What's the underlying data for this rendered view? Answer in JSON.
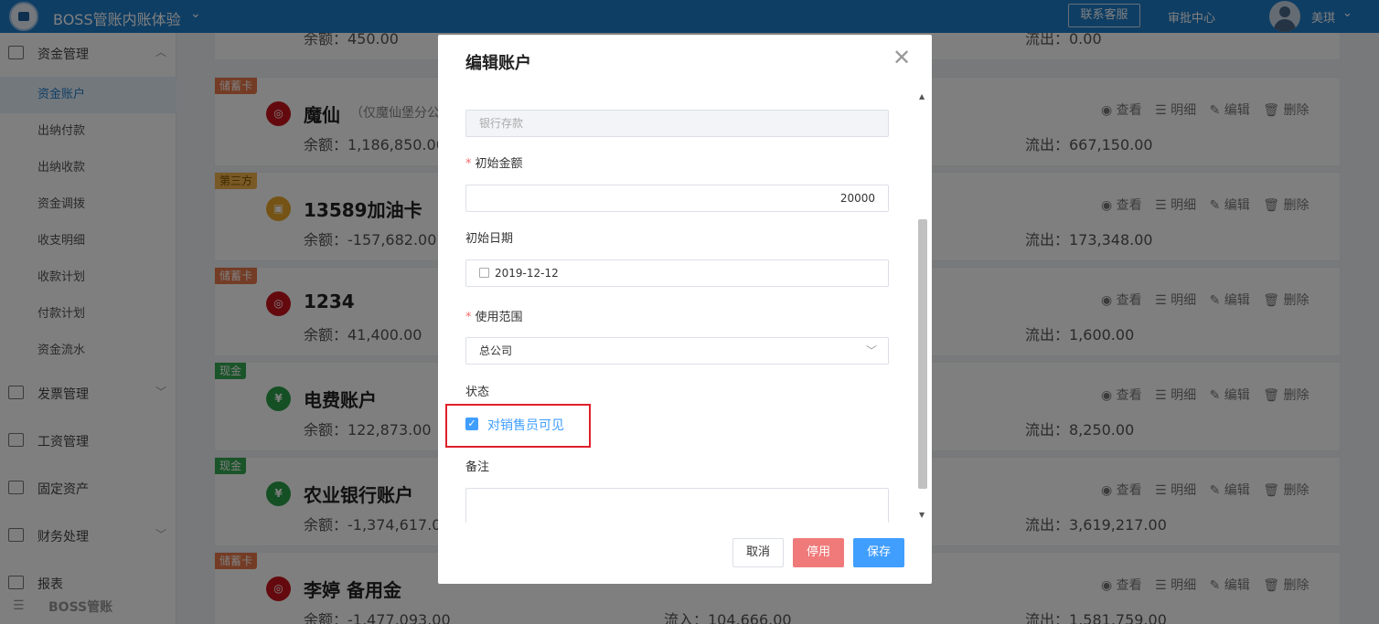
{
  "topbar": {
    "app_title": "BOSS管账内账体验",
    "contact_label": "联系客服",
    "approval_label": "审批中心",
    "username": "美琪"
  },
  "sidebar": {
    "fund_group": "资金管理",
    "items": [
      "资金账户",
      "出纳付款",
      "出纳收款",
      "资金调拨",
      "收支明细",
      "收款计划",
      "付款计划",
      "资金流水"
    ],
    "groups": [
      "发票管理",
      "工资管理",
      "固定资产",
      "财务处理",
      "报表"
    ],
    "bottom_brand": "BOSS管账"
  },
  "cards_top_partial": {
    "balance": "余额：450.00",
    "out": "流出：0.00"
  },
  "cards": [
    {
      "tag": "储蓄卡",
      "name": "魔仙",
      "sub": "（仅魔仙堡分公",
      "balance": "余额：1,186,850.00",
      "in": "",
      "out": "流出：667,150.00"
    },
    {
      "tag": "第三方",
      "name": "13589加油卡",
      "sub": "",
      "balance": "余额：-157,682.00",
      "in": "",
      "out": "流出：173,348.00"
    },
    {
      "tag": "储蓄卡",
      "name": "1234",
      "sub": "",
      "balance": "余额：41,400.00",
      "in": "",
      "out": "流出：1,600.00"
    },
    {
      "tag": "现金",
      "name": "电费账户",
      "sub": "",
      "balance": "余额：122,873.00",
      "in": "",
      "out": "流出：8,250.00"
    },
    {
      "tag": "现金",
      "name": "农业银行账户",
      "sub": "",
      "balance": "余额：-1,374,617.00",
      "in": "",
      "out": "流出：3,619,217.00"
    },
    {
      "tag": "储蓄卡",
      "name": "李婷 备用金",
      "sub": "",
      "balance": "余额：-1,477,093.00",
      "in": "流入：104,666.00",
      "out": "流出：1,581,759.00"
    }
  ],
  "card_actions": {
    "view": "查看",
    "detail": "明细",
    "edit": "编辑",
    "delete": "删除"
  },
  "dialog": {
    "title": "编辑账户",
    "subject_value": "银行存款",
    "initial_amount_label": "初始金额",
    "initial_amount_value": "20000",
    "initial_date_label": "初始日期",
    "initial_date_value": "2019-12-12",
    "scope_label": "使用范围",
    "scope_value": "总公司",
    "status_label": "状态",
    "visible_to_sales_label": "对销售员可见",
    "visible_to_sales_checked": true,
    "remark_label": "备注",
    "cancel_label": "取消",
    "disable_label": "停用",
    "save_label": "保存"
  }
}
